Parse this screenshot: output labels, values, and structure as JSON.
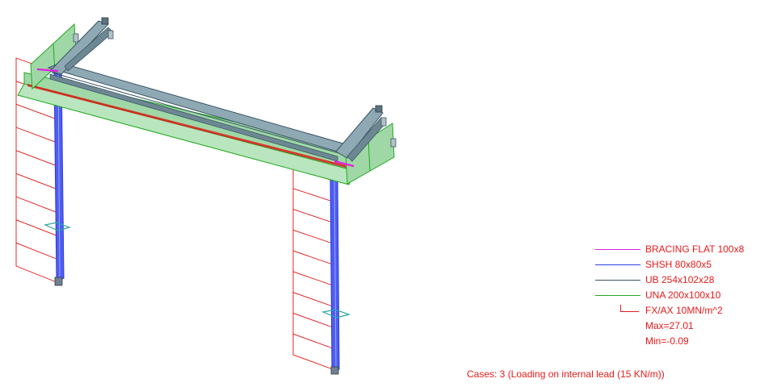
{
  "colors": {
    "bracing": "#e020e0",
    "shsh": "#2b3de0",
    "ub": "#3a5565",
    "una": "#22aa22",
    "text": "#e81a1a",
    "diagram": "#e01010",
    "beam_fill": "#8fa9b4",
    "beam_fill_dark": "#6d8893",
    "angle_fill": "#9fd8a6",
    "column_fill": "#4e5df0"
  },
  "legend": {
    "items": [
      {
        "label": "BRACING FLAT 100x8",
        "color_key": "bracing"
      },
      {
        "label": "SHSH 80x80x5",
        "color_key": "shsh"
      },
      {
        "label": "UB 254x102x28",
        "color_key": "ub"
      },
      {
        "label": "UNA 200x100x10",
        "color_key": "una"
      }
    ],
    "map_label": "FX/AX 10MN/m^2",
    "max_label": "Max=27.01",
    "min_label": "Min=-0.09"
  },
  "cases_label": "Cases: 3 (Loading on internal lead (15 KN/m))"
}
